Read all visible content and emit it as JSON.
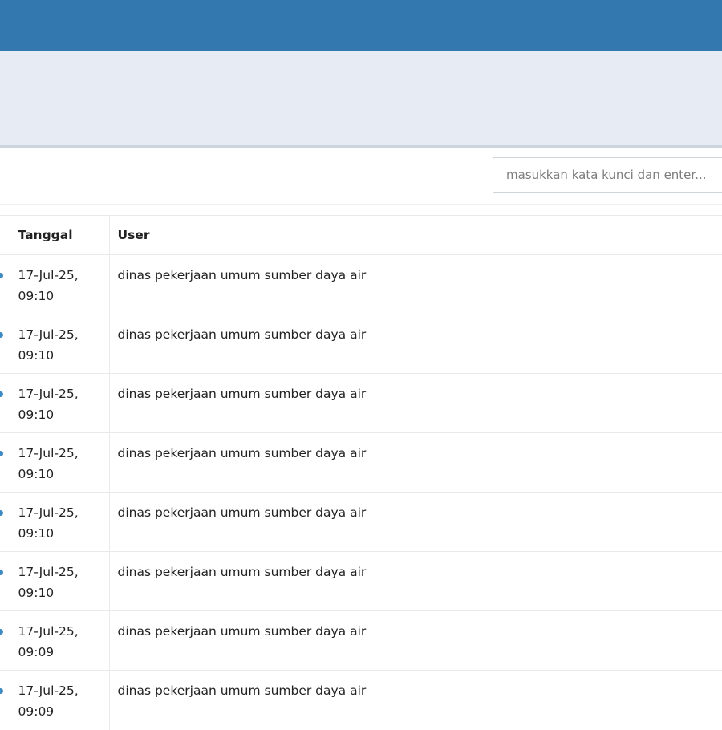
{
  "search": {
    "placeholder": "masukkan kata kunci dan enter..."
  },
  "colors": {
    "topbar": "#3478b0",
    "subheader": "#e7ebf3"
  },
  "table": {
    "headers": {
      "date": "Tanggal",
      "user": "User"
    },
    "rows": [
      {
        "date": "17-Jul-25,\n09:10",
        "user": "dinas pekerjaan umum sumber daya air"
      },
      {
        "date": "17-Jul-25,\n09:10",
        "user": "dinas pekerjaan umum sumber daya air"
      },
      {
        "date": "17-Jul-25,\n09:10",
        "user": "dinas pekerjaan umum sumber daya air"
      },
      {
        "date": "17-Jul-25,\n09:10",
        "user": "dinas pekerjaan umum sumber daya air"
      },
      {
        "date": "17-Jul-25,\n09:10",
        "user": "dinas pekerjaan umum sumber daya air"
      },
      {
        "date": "17-Jul-25,\n09:10",
        "user": "dinas pekerjaan umum sumber daya air"
      },
      {
        "date": "17-Jul-25,\n09:09",
        "user": "dinas pekerjaan umum sumber daya air"
      },
      {
        "date": "17-Jul-25,\n09:09",
        "user": "dinas pekerjaan umum sumber daya air"
      }
    ]
  }
}
